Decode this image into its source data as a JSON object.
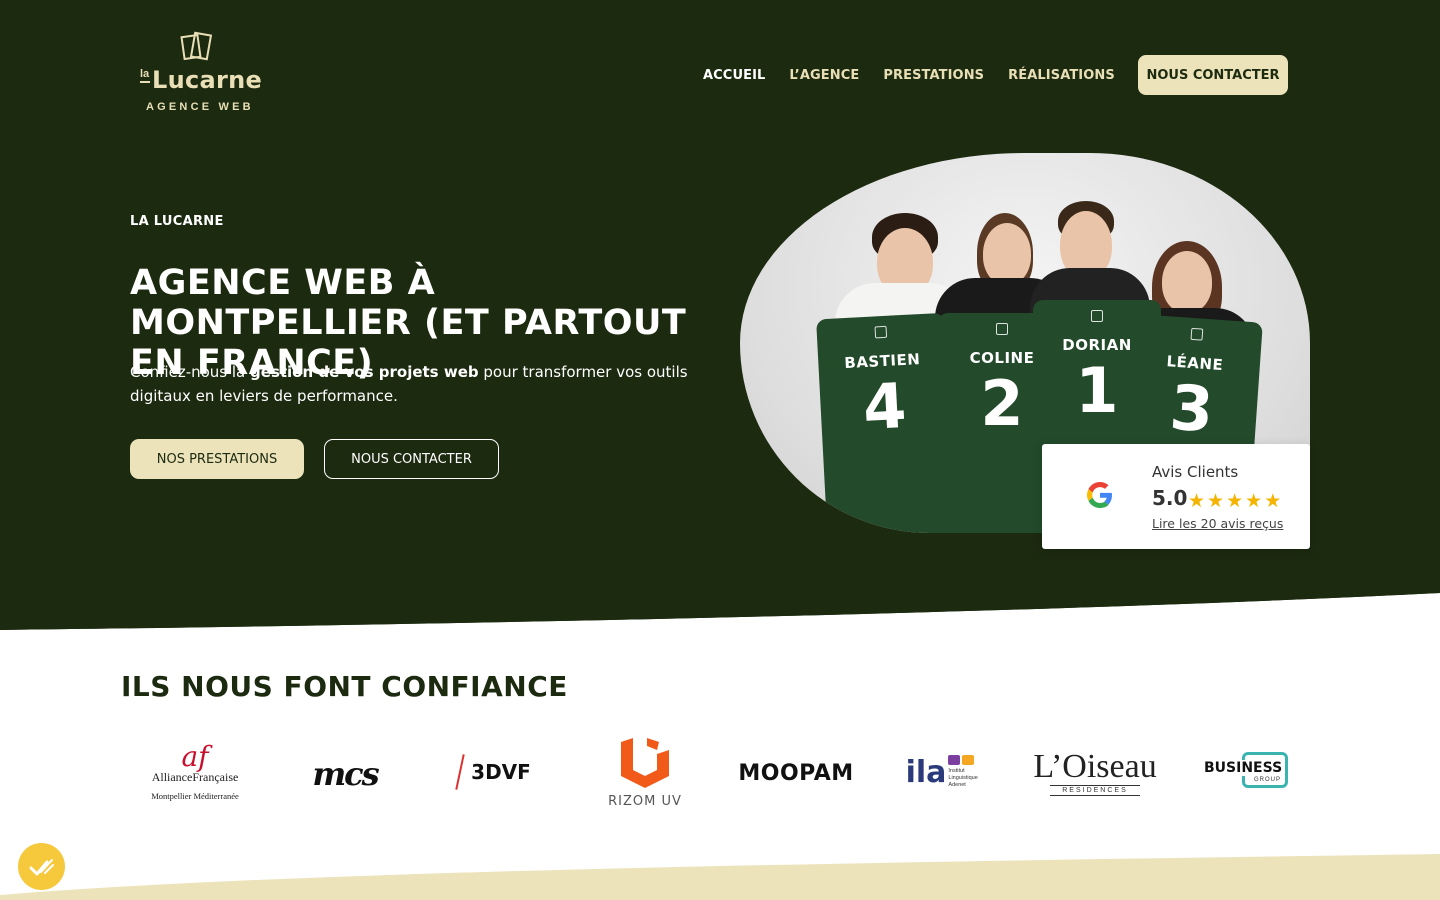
{
  "header": {
    "logo": {
      "prefix": "la",
      "name": "Lucarne",
      "tagline": "AGENCE WEB"
    },
    "nav": [
      {
        "label": "ACCUEIL"
      },
      {
        "label": "L’AGENCE"
      },
      {
        "label": "PRESTATIONS"
      },
      {
        "label": "RÉALISATIONS"
      }
    ],
    "cta_label": "NOUS CONTACTER"
  },
  "hero": {
    "kicker": "LA LUCARNE",
    "title": "AGENCE WEB À MONTPELLIER (ET PARTOUT EN FRANCE)",
    "description": {
      "before": "Confiez-nous la ",
      "bold": "gestion de vos projets web",
      "after": " pour transformer vos outils digitaux en leviers de performance."
    },
    "primary_button": "NOS PRESTATIONS",
    "secondary_button": "NOUS CONTACTER",
    "team": [
      {
        "name": "BASTIEN",
        "number": "4"
      },
      {
        "name": "COLINE",
        "number": "2"
      },
      {
        "name": "DORIAN",
        "number": "1"
      },
      {
        "name": "LÉANE",
        "number": "3"
      }
    ]
  },
  "review": {
    "title": "Avis Clients",
    "score": "5.0",
    "stars": 5,
    "link": "Lire les 20 avis reçus"
  },
  "clients": {
    "title": "ILS NOUS FONT CONFIANCE",
    "logos": [
      {
        "mark": "af",
        "name": "AllianceFrançaise",
        "sub": "Montpellier Méditerranée"
      },
      {
        "name": "mcs"
      },
      {
        "name": "3DVF"
      },
      {
        "name": "RIZOM UV"
      },
      {
        "name": "MOOPAM"
      },
      {
        "name": "ila",
        "sub": "Institut Linguistique Adenet"
      },
      {
        "name": "L’Oiseau",
        "sub": "RESIDENCES"
      },
      {
        "name": "BUSINESS",
        "sub": "GROUP"
      }
    ]
  },
  "colors": {
    "hero_bg": "#1c2a10",
    "cream": "#ece3bb",
    "star": "#f4b400",
    "badge": "#f6c83c"
  }
}
